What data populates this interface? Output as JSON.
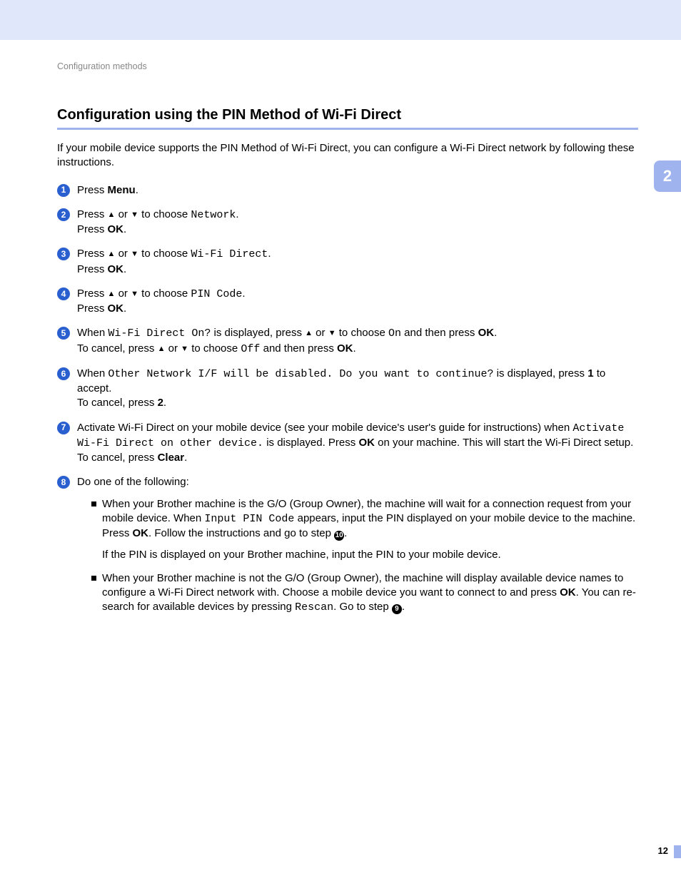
{
  "breadcrumb": "Configuration methods",
  "title": "Configuration using the PIN Method of Wi-Fi Direct",
  "intro": "If your mobile device supports the PIN Method of Wi-Fi Direct, you can configure a Wi-Fi Direct network by following these instructions.",
  "section_tab": "2",
  "page_number": "12",
  "steps": {
    "s1": {
      "press": "Press ",
      "menu": "Menu",
      "end": "."
    },
    "s2": {
      "press": "Press ",
      "or": " or ",
      "choose": " to choose ",
      "opt": "Network",
      "end": ".",
      "press_ok": "Press ",
      "ok": "OK",
      "end2": "."
    },
    "s3": {
      "press": "Press ",
      "or": " or ",
      "choose": " to choose ",
      "opt": "Wi-Fi Direct",
      "end": ".",
      "press_ok": "Press ",
      "ok": "OK",
      "end2": "."
    },
    "s4": {
      "press": "Press ",
      "or": " or ",
      "choose": " to choose ",
      "opt": "PIN Code",
      "end": ".",
      "press_ok": "Press ",
      "ok": "OK",
      "end2": "."
    },
    "s5": {
      "when": "When ",
      "disp": "Wi-Fi Direct On?",
      "isdisp": " is displayed, press ",
      "or": " or ",
      "choose": " to choose ",
      "on": "On",
      "then": " and then press ",
      "ok": "OK",
      "end": ".",
      "cancel": "To cancel, press ",
      "or2": " or ",
      "choose2": " to choose ",
      "off": "Off",
      "then2": " and then press ",
      "ok2": "OK",
      "end2": "."
    },
    "s6": {
      "when": "When ",
      "disp": "Other Network I/F will be disabled. Do you want to continue?",
      "isdisp": " is displayed, press ",
      "one": "1",
      "accept": " to accept.",
      "cancel": "To cancel, press ",
      "two": "2",
      "end": "."
    },
    "s7": {
      "a": "Activate Wi-Fi Direct on your mobile device (see your mobile device's user's guide for instructions) when ",
      "disp": "Activate Wi-Fi Direct on other device.",
      "b": " is displayed. Press ",
      "ok": "OK",
      "c": " on your machine. This will start the Wi-Fi Direct setup.",
      "cancel": "To cancel, press ",
      "clear": "Clear",
      "end": "."
    },
    "s8": {
      "lead": "Do one of the following:",
      "sub1": {
        "a": "When your Brother machine is the G/O (Group Owner), the machine will wait for a connection request from your mobile device. When ",
        "code": "Input PIN Code",
        "b": " appears, input the PIN displayed on your mobile device to the machine. Press ",
        "ok": "OK",
        "c": ". Follow the instructions and go to step ",
        "badge": "10",
        "d": ".",
        "note": "If the PIN is displayed on your Brother machine, input the PIN to your mobile device."
      },
      "sub2": {
        "a": "When your Brother machine is not the G/O (Group Owner), the machine will display available device names to configure a Wi-Fi Direct network with. Choose a mobile device you want to connect to and press ",
        "ok": "OK",
        "b": ". You can re-search for available devices by pressing ",
        "code": "Rescan",
        "c": ". Go to step ",
        "badge": "9",
        "d": "."
      }
    }
  }
}
